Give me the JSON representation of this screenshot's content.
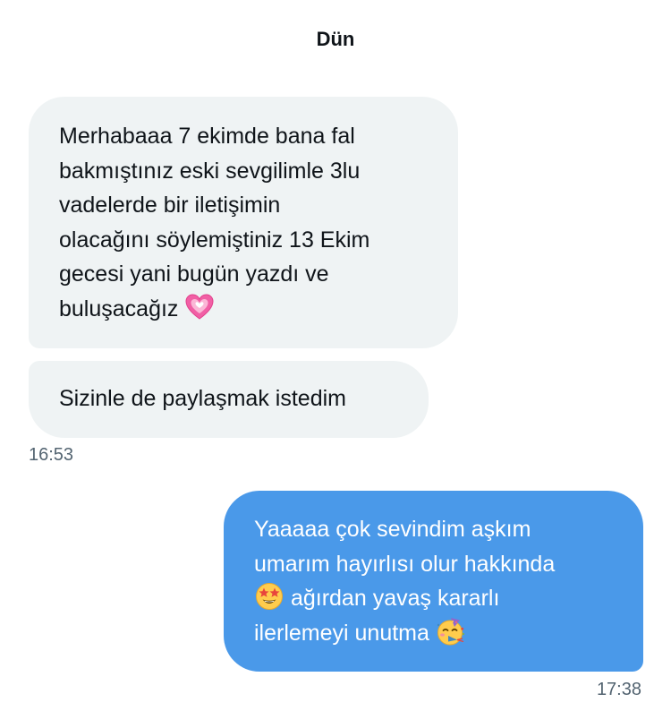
{
  "conversation": {
    "date_divider": "Dün",
    "messages": [
      {
        "direction": "received",
        "lines": [
          "Merhabaaa 7 ekimde bana fal",
          "bakmıştınız eski sevgilimle 3lu",
          "vadelerde bir iletişimin",
          "olacağını söylemiştiniz 13 Ekim",
          "gecesi yani bugün yazdı ve",
          "buluşacağız"
        ],
        "emoji": "sparkling-heart"
      },
      {
        "direction": "received",
        "lines": [
          "Sizinle de paylaşmak istedim"
        ]
      },
      {
        "direction": "sent",
        "lines": [
          "Yaaaaa çok sevindim aşkım",
          "umarım hayırlısı olur hakkında",
          "ağırdan yavaş kararlı",
          "ilerlemeyi unutma"
        ],
        "emojis": [
          "star-struck",
          "partying-face"
        ]
      }
    ],
    "timestamps": {
      "received_group": "16:53",
      "sent_group": "17:38"
    }
  },
  "colors": {
    "received_bubble": "#eff3f4",
    "sent_bubble": "#4a99e9",
    "text_primary": "#0f1419",
    "text_secondary": "#536471"
  }
}
